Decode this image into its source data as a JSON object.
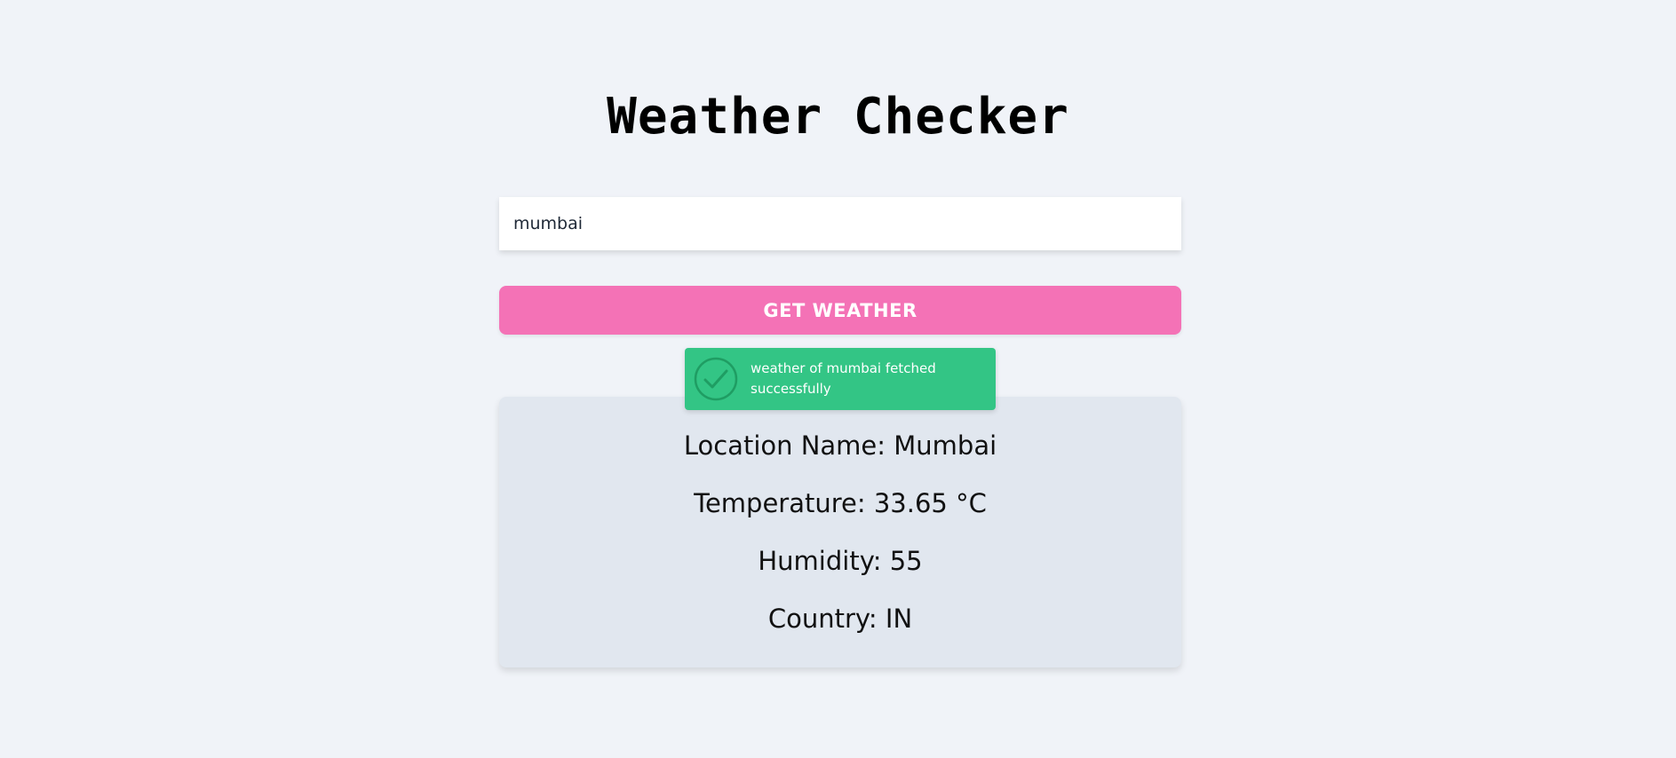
{
  "header": {
    "title": "Weather Checker"
  },
  "search": {
    "value": "mumbai",
    "placeholder": ""
  },
  "actions": {
    "get_weather_label": "GET WEATHER"
  },
  "toast": {
    "message": "weather of mumbai fetched successfully",
    "icon": "check-circle-icon",
    "color": "#33c585"
  },
  "result": {
    "location": "Location Name: Mumbai",
    "temperature": "Temperature: 33.65 °C",
    "humidity": "Humidity: 55",
    "country": "Country: IN"
  },
  "colors": {
    "background": "#f0f3f8",
    "button": "#f472b6",
    "card": "#e1e7ef"
  }
}
